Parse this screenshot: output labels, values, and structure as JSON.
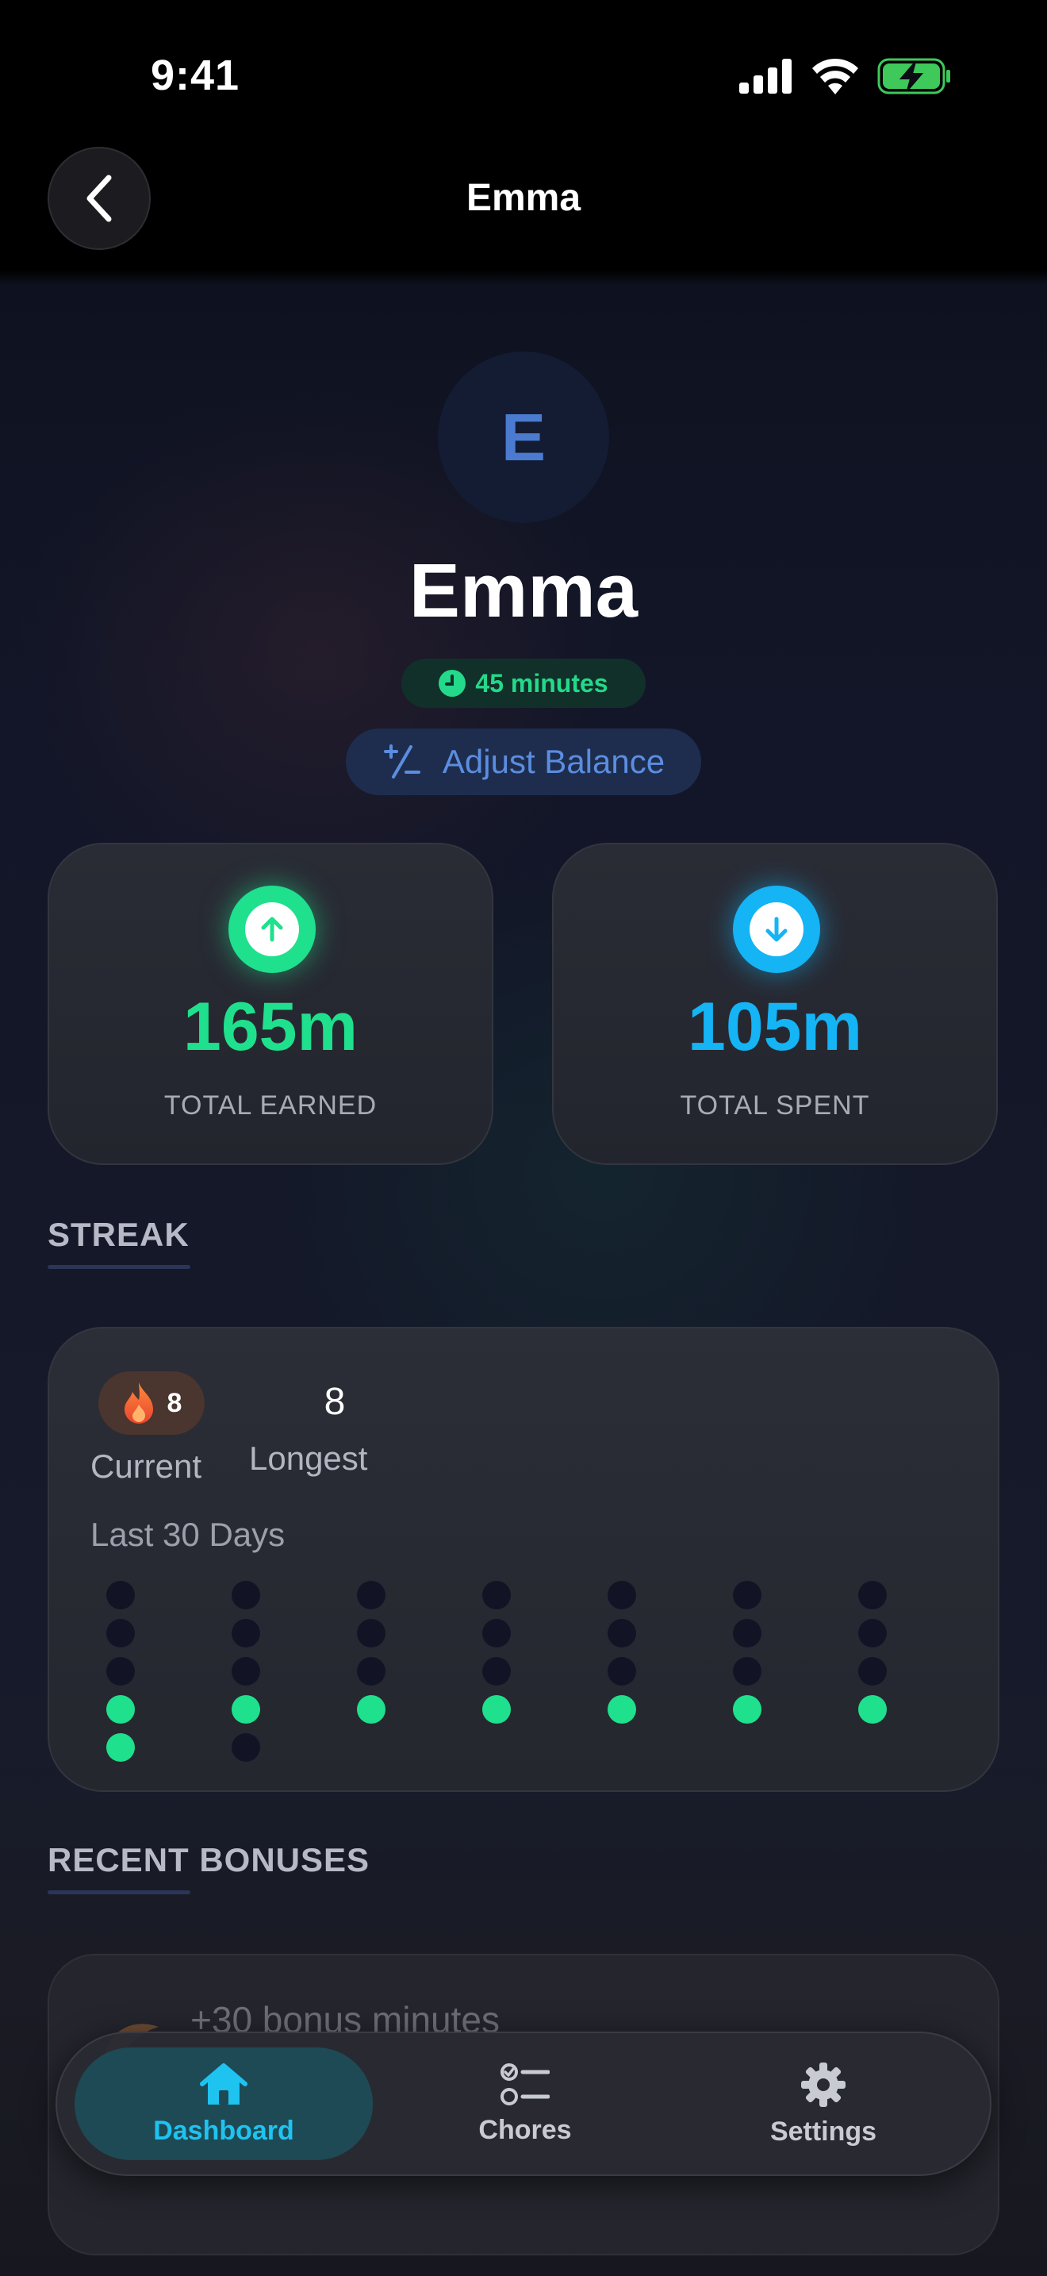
{
  "status_bar": {
    "time": "9:41",
    "icons": [
      "signal-icon",
      "wifi-icon",
      "battery-charging-icon"
    ]
  },
  "nav": {
    "title": "Emma",
    "back_icon": "chevron-left-icon"
  },
  "profile": {
    "initial": "E",
    "name": "Emma",
    "balance": "45 minutes",
    "adjust_label": "Adjust Balance"
  },
  "stats": {
    "earned": {
      "value": "165m",
      "label": "TOTAL EARNED"
    },
    "spent": {
      "value": "105m",
      "label": "TOTAL SPENT"
    }
  },
  "streak": {
    "section_title": "STREAK",
    "current_value": "8",
    "current_label": "Current",
    "longest_value": "8",
    "longest_label": "Longest",
    "history_label": "Last 30 Days",
    "days_completed": [
      false,
      false,
      false,
      false,
      false,
      false,
      false,
      false,
      false,
      false,
      false,
      false,
      false,
      false,
      false,
      false,
      false,
      false,
      false,
      false,
      false,
      true,
      true,
      true,
      true,
      true,
      true,
      true,
      true,
      false
    ]
  },
  "bonuses": {
    "section_title": "RECENT BONUSES",
    "items": [
      {
        "text": "+30 bonus minutes"
      }
    ]
  },
  "tab_bar": {
    "tabs": [
      {
        "label": "Dashboard",
        "icon": "house-icon",
        "active": true
      },
      {
        "label": "Chores",
        "icon": "checklist-icon",
        "active": false
      },
      {
        "label": "Settings",
        "icon": "gear-icon",
        "active": false
      }
    ]
  },
  "colors": {
    "earned": "#1fe08c",
    "spent": "#14b4f5",
    "accent_blue": "#5b8de0",
    "dot_done": "#1fe08c",
    "dot_missed": "#121426"
  }
}
